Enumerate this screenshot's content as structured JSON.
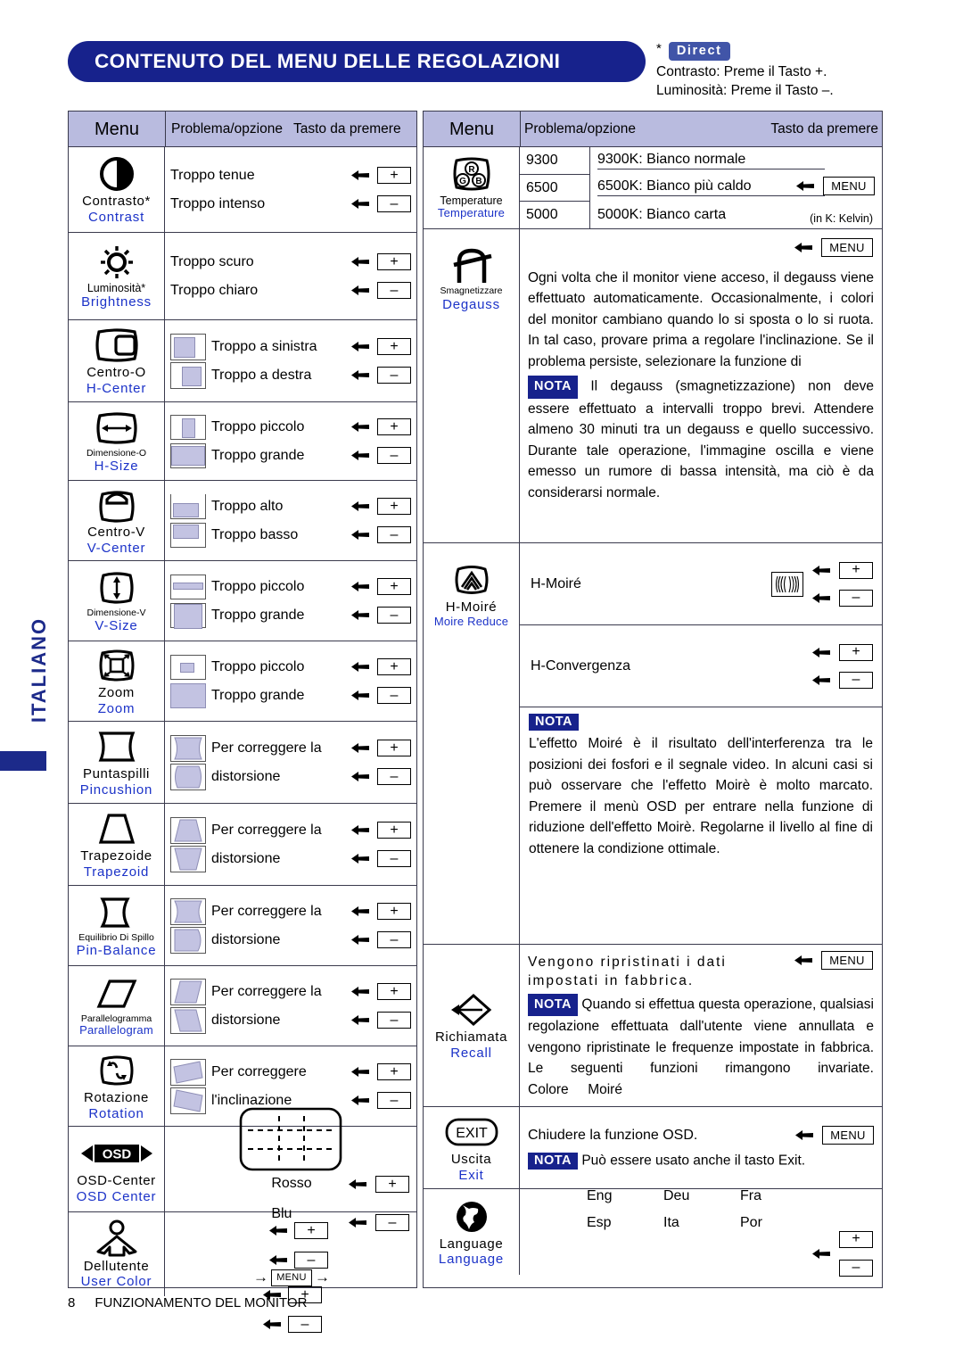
{
  "page": {
    "title": "CONTENUTO DEL MENU DELLE REGOLAZIONI",
    "side_tab": "ITALIANO",
    "footer_page": "8",
    "footer_text": "FUNZIONAMENTO DEL MONITOR",
    "colors": {
      "accent": "#17228c",
      "header_bg": "#b9bbdf",
      "english_label": "#1b32c8",
      "thumb_fill": "#c3c3e2"
    }
  },
  "direct_note": {
    "asterisk": "*",
    "badge": "Direct",
    "line1": "Contrasto: Preme il Tasto +.",
    "line2": "Luminosità: Preme il Tasto –."
  },
  "table_headers": {
    "left": {
      "menu": "Menu",
      "problem": "Problema/opzione",
      "key": "Tasto da premere"
    },
    "right": {
      "menu": "Menu",
      "problem": "Problema/opzione",
      "key": "Tasto da premere"
    }
  },
  "keys": {
    "plus": "+",
    "minus": "–",
    "menu": "MENU"
  },
  "left_rows": [
    {
      "icon": "contrast-icon",
      "label_it": "Contrasto*",
      "label_en": "Contrast",
      "options": [
        {
          "text": "Troppo tenue",
          "key": "+"
        },
        {
          "text": "Troppo intenso",
          "key": "–"
        }
      ]
    },
    {
      "icon": "brightness-icon",
      "label_it": "Luminosità*",
      "label_en": "Brightness",
      "options": [
        {
          "text": "Troppo scuro",
          "key": "+"
        },
        {
          "text": "Troppo chiaro",
          "key": "–"
        }
      ]
    },
    {
      "icon": "h-center-icon",
      "label_it": "Centro-O",
      "label_en": "H-Center",
      "options": [
        {
          "text": "Troppo a sinistra",
          "key": "+",
          "thumb": "box-left"
        },
        {
          "text": "Troppo a destra",
          "key": "–",
          "thumb": "box-right"
        }
      ]
    },
    {
      "icon": "h-size-icon",
      "label_it": "Dimensione-O",
      "label_en": "H-Size",
      "options": [
        {
          "text": "Troppo piccolo",
          "key": "+",
          "thumb": "narrow"
        },
        {
          "text": "Troppo grande",
          "key": "–",
          "thumb": "wide"
        }
      ]
    },
    {
      "icon": "v-center-icon",
      "label_it": "Centro-V",
      "label_en": "V-Center",
      "options": [
        {
          "text": "Troppo alto",
          "key": "+",
          "thumb": "box-bottom"
        },
        {
          "text": "Troppo basso",
          "key": "–",
          "thumb": "box-top"
        }
      ]
    },
    {
      "icon": "v-size-icon",
      "label_it": "Dimensione-V",
      "label_en": "V-Size",
      "options": [
        {
          "text": "Troppo piccolo",
          "key": "+",
          "thumb": "short"
        },
        {
          "text": "Troppo grande",
          "key": "–",
          "thumb": "tall"
        }
      ]
    },
    {
      "icon": "zoom-icon",
      "label_it": "Zoom",
      "label_en": "Zoom",
      "options": [
        {
          "text": "Troppo piccolo",
          "key": "+",
          "thumb": "tiny"
        },
        {
          "text": "Troppo grande",
          "key": "–",
          "thumb": "full"
        }
      ]
    },
    {
      "icon": "pincushion-icon",
      "label_it": "Puntaspilli",
      "label_en": "Pincushion",
      "options": [
        {
          "text": "Per correggere la",
          "key": "+",
          "thumb": "pin-in"
        },
        {
          "text": "distorsione",
          "key": "–",
          "thumb": "pin-out"
        }
      ]
    },
    {
      "icon": "trapezoid-icon",
      "label_it": "Trapezoide",
      "label_en": "Trapezoid",
      "options": [
        {
          "text": "Per correggere la",
          "key": "+",
          "thumb": "trap-up"
        },
        {
          "text": "distorsione",
          "key": "–",
          "thumb": "trap-down"
        }
      ]
    },
    {
      "icon": "pin-balance-icon",
      "label_it": "Equilibrio Di Spillo",
      "label_en": "Pin-Balance",
      "options": [
        {
          "text": "Per correggere la",
          "key": "+",
          "thumb": "pb-left"
        },
        {
          "text": "distorsione",
          "key": "–",
          "thumb": "pb-right"
        }
      ]
    },
    {
      "icon": "parallelogram-icon",
      "label_it": "Parallelogramma",
      "label_en": "Parallelogram",
      "options": [
        {
          "text": "Per correggere la",
          "key": "+",
          "thumb": "par-right"
        },
        {
          "text": "distorsione",
          "key": "–",
          "thumb": "par-left"
        }
      ]
    },
    {
      "icon": "rotation-icon",
      "label_it": "Rotazione",
      "label_en": "Rotation",
      "options": [
        {
          "text": "Per correggere",
          "key": "+",
          "thumb": "rot-ccw"
        },
        {
          "text": "l'inclinazione",
          "key": "–",
          "thumb": "rot-cw"
        }
      ]
    }
  ],
  "osd_center_row": {
    "icon": "osd-center-icon",
    "icon_text": "OSD",
    "label_it": "OSD-Center",
    "label_en": "OSD Center",
    "keys": [
      "+",
      "–"
    ]
  },
  "user_color_row": {
    "icon": "user-color-icon",
    "label_it": "Dellutente",
    "label_en": "User Color",
    "rows": [
      {
        "text": "Rosso",
        "key1": "+",
        "key2": "+"
      },
      {
        "text": "Blu",
        "key1": "–",
        "key2": "–"
      }
    ],
    "middle_key": "MENU",
    "arrow": "→"
  },
  "right_rows": {
    "temperature": {
      "icon": "rgb-icon",
      "icon_letters": [
        "R",
        "G",
        "B"
      ],
      "label_it": "Temperature",
      "label_en": "Temperature",
      "entries": [
        {
          "value": "9300",
          "desc": "9300K: Bianco normale"
        },
        {
          "value": "6500",
          "desc": "6500K: Bianco più caldo"
        },
        {
          "value": "5000",
          "desc": "5000K: Bianco carta"
        }
      ],
      "key": "MENU",
      "note": "(in K: Kelvin)"
    },
    "degauss": {
      "icon": "degauss-icon",
      "label_it": "Smagnetizzare",
      "label_en": "Degauss",
      "key": "MENU",
      "paragraph": "Ogni volta che il monitor viene acceso, il degauss viene effettuato automaticamente. Occasionalmente, i colori del monitor cambiano quando lo si sposta o lo si ruota. In tal caso, provare prima a regolare l'inclinazione. Se il problema persiste, selezionare la funzione di",
      "nota_badge": "NOTA",
      "nota_text": "Il degauss (smagnetizzazione) non deve essere effettuato a intervalli troppo brevi. Attendere almeno 30 minuti tra un degauss e quello successivo. Durante tale operazione, l'immagine oscilla e viene emesso un rumore di bassa intensità, ma ciò è da considerarsi normale."
    },
    "moire": {
      "icon": "moire-icon",
      "label_it": "H-Moiré",
      "label_en": "Moire Reduce",
      "items": [
        {
          "text": "H-Moiré",
          "keys": [
            "+",
            "–"
          ],
          "has_wave_icon": true
        },
        {
          "text": "H-Convergenza",
          "keys": [
            "+",
            "–"
          ],
          "has_wave_icon": false
        }
      ],
      "nota_badge": "NOTA",
      "nota_text": "L'effetto Moiré è il risultato dell'interferenza tra le posizioni dei fosfori e il segnale video. In alcuni casi si può osservare che l'effetto Moirè è molto marcato. Premere il menù OSD per entrare nella funzione di riduzione dell'effetto Moirè. Regolarne il livello al fine di ottenere la condizione ottimale."
    },
    "recall": {
      "icon": "recall-icon",
      "label_it": "Richiamata",
      "label_en": "Recall",
      "key": "MENU",
      "top_text": "Vengono ripristinati i dati impostati in fabbrica.",
      "nota_badge": "NOTA",
      "nota_text": "Quando si effettua questa operazione, qualsiasi regolazione effettuata dall'utente viene annullata e vengono ripristinate le frequenze impostate in fabbrica. Le seguenti funzioni rimangono invariate.",
      "nota_tail": "Colore     Moiré"
    },
    "exit": {
      "icon": "exit-icon",
      "icon_text": "EXIT",
      "label_it": "Uscita",
      "label_en": "Exit",
      "key": "MENU",
      "line1": "Chiudere la funzione OSD.",
      "nota_badge": "NOTA",
      "nota_text": "Può essere usato anche il tasto Exit."
    },
    "language": {
      "icon": "globe-icon",
      "label_it": "Language",
      "label_en": "Language",
      "options": [
        "Eng",
        "Deu",
        "Fra",
        "Esp",
        "Ita",
        "Por"
      ],
      "keys": [
        "+",
        "–"
      ]
    }
  }
}
